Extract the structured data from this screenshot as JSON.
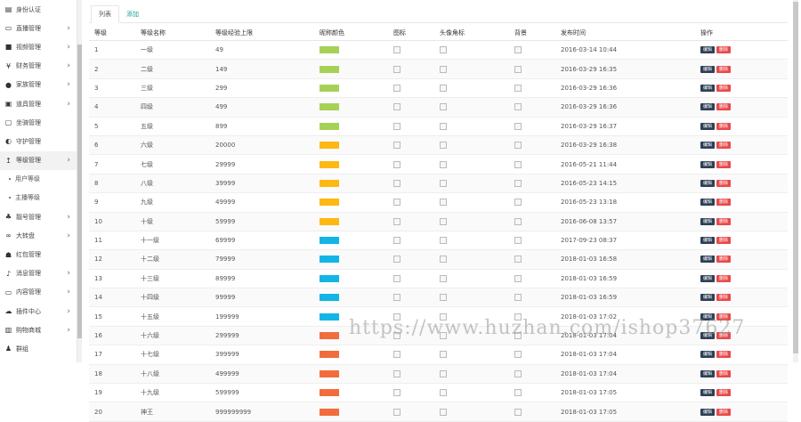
{
  "sidebar": {
    "items": [
      {
        "label": "身份认证",
        "icon": "id-card-icon",
        "glyph": "▤",
        "arrow": false,
        "sub": false
      },
      {
        "label": "直播管理",
        "icon": "monitor-icon",
        "glyph": "▭",
        "arrow": true,
        "sub": false
      },
      {
        "label": "视频管理",
        "icon": "video-icon",
        "glyph": "■",
        "arrow": true,
        "sub": false
      },
      {
        "label": "财务管理",
        "icon": "yen-icon",
        "glyph": "¥",
        "arrow": true,
        "sub": false
      },
      {
        "label": "家族管理",
        "icon": "users-icon",
        "glyph": "●",
        "arrow": true,
        "sub": false
      },
      {
        "label": "道具管理",
        "icon": "gift-icon",
        "glyph": "▣",
        "arrow": true,
        "sub": false
      },
      {
        "label": "坐骑管理",
        "icon": "car-icon",
        "glyph": "▢",
        "arrow": false,
        "sub": false
      },
      {
        "label": "守护管理",
        "icon": "shield-icon",
        "glyph": "◐",
        "arrow": false,
        "sub": false
      },
      {
        "label": "等级管理",
        "icon": "level-icon",
        "glyph": "↥",
        "arrow": true,
        "sub": false,
        "active": true
      },
      {
        "label": "用户等级",
        "icon": "",
        "glyph": "",
        "arrow": false,
        "sub": true
      },
      {
        "label": "主播等级",
        "icon": "",
        "glyph": "",
        "arrow": false,
        "sub": true
      },
      {
        "label": "靓号管理",
        "icon": "sitemap-icon",
        "glyph": "♣",
        "arrow": true,
        "sub": false
      },
      {
        "label": "大转盘",
        "icon": "glasses-icon",
        "glyph": "∞",
        "arrow": true,
        "sub": false
      },
      {
        "label": "红包管理",
        "icon": "gamepad-icon",
        "glyph": "☗",
        "arrow": false,
        "sub": false
      },
      {
        "label": "消息管理",
        "icon": "bell-icon",
        "glyph": "♪",
        "arrow": true,
        "sub": false
      },
      {
        "label": "内容管理",
        "icon": "desktop-icon",
        "glyph": "▭",
        "arrow": true,
        "sub": false
      },
      {
        "label": "插件中心",
        "icon": "cloud-icon",
        "glyph": "☁",
        "arrow": true,
        "sub": false
      },
      {
        "label": "购物商城",
        "icon": "shop-icon",
        "glyph": "▥",
        "arrow": true,
        "sub": false
      },
      {
        "label": "群组",
        "icon": "user-icon",
        "glyph": "♟",
        "arrow": false,
        "sub": false
      }
    ]
  },
  "tabs": [
    {
      "label": "列表",
      "active": true
    },
    {
      "label": "添加",
      "active": false
    }
  ],
  "table": {
    "headers": [
      "等级",
      "等级名称",
      "等级经验上限",
      "昵称颜色",
      "图标",
      "头像角标",
      "背景",
      "发布时间",
      "操作"
    ],
    "edit_label": "编辑",
    "delete_label": "删除",
    "rows": [
      {
        "level": "1",
        "name": "一级",
        "exp": "49",
        "color": "#a6d157",
        "time": "2016-03-14 10:44"
      },
      {
        "level": "2",
        "name": "二级",
        "exp": "149",
        "color": "#a6d157",
        "time": "2016-03-29 16:35"
      },
      {
        "level": "3",
        "name": "三级",
        "exp": "299",
        "color": "#a6d157",
        "time": "2016-03-29 16:36"
      },
      {
        "level": "4",
        "name": "四级",
        "exp": "499",
        "color": "#a6d157",
        "time": "2016-03-29 16:36"
      },
      {
        "level": "5",
        "name": "五级",
        "exp": "899",
        "color": "#a6d157",
        "time": "2016-03-29 16:37"
      },
      {
        "level": "6",
        "name": "六级",
        "exp": "20000",
        "color": "#fdb813",
        "time": "2016-03-29 16:38"
      },
      {
        "level": "7",
        "name": "七级",
        "exp": "29999",
        "color": "#fdb813",
        "time": "2016-05-21 11:44"
      },
      {
        "level": "8",
        "name": "八级",
        "exp": "39999",
        "color": "#fdb813",
        "time": "2016-05-23 14:15"
      },
      {
        "level": "9",
        "name": "九级",
        "exp": "49999",
        "color": "#fdb813",
        "time": "2016-05-23 13:18"
      },
      {
        "level": "10",
        "name": "十级",
        "exp": "59999",
        "color": "#fdb813",
        "time": "2016-06-08 13:57"
      },
      {
        "level": "11",
        "name": "十一级",
        "exp": "69999",
        "color": "#12b5e6",
        "time": "2017-09-23 08:37"
      },
      {
        "level": "12",
        "name": "十二级",
        "exp": "79999",
        "color": "#12b5e6",
        "time": "2018-01-03 16:58"
      },
      {
        "level": "13",
        "name": "十三级",
        "exp": "89999",
        "color": "#12b5e6",
        "time": "2018-01-03 16:59"
      },
      {
        "level": "14",
        "name": "十四级",
        "exp": "99999",
        "color": "#12b5e6",
        "time": "2018-01-03 16:59"
      },
      {
        "level": "15",
        "name": "十五级",
        "exp": "199999",
        "color": "#12b5e6",
        "time": "2018-01-03 17:02"
      },
      {
        "level": "16",
        "name": "十六级",
        "exp": "299999",
        "color": "#f26d3d",
        "time": "2018-01-03 17:04"
      },
      {
        "level": "17",
        "name": "十七级",
        "exp": "399999",
        "color": "#f26d3d",
        "time": "2018-01-03 17:04"
      },
      {
        "level": "18",
        "name": "十八级",
        "exp": "499999",
        "color": "#f26d3d",
        "time": "2018-01-03 17:04"
      },
      {
        "level": "19",
        "name": "十九级",
        "exp": "599999",
        "color": "#f26d3d",
        "time": "2018-01-03 17:05"
      },
      {
        "level": "20",
        "name": "神王",
        "exp": "999999999",
        "color": "#f26d3d",
        "time": "2018-01-03 17:05"
      }
    ]
  },
  "watermark": "https://www.huzhan.com/ishop37627"
}
